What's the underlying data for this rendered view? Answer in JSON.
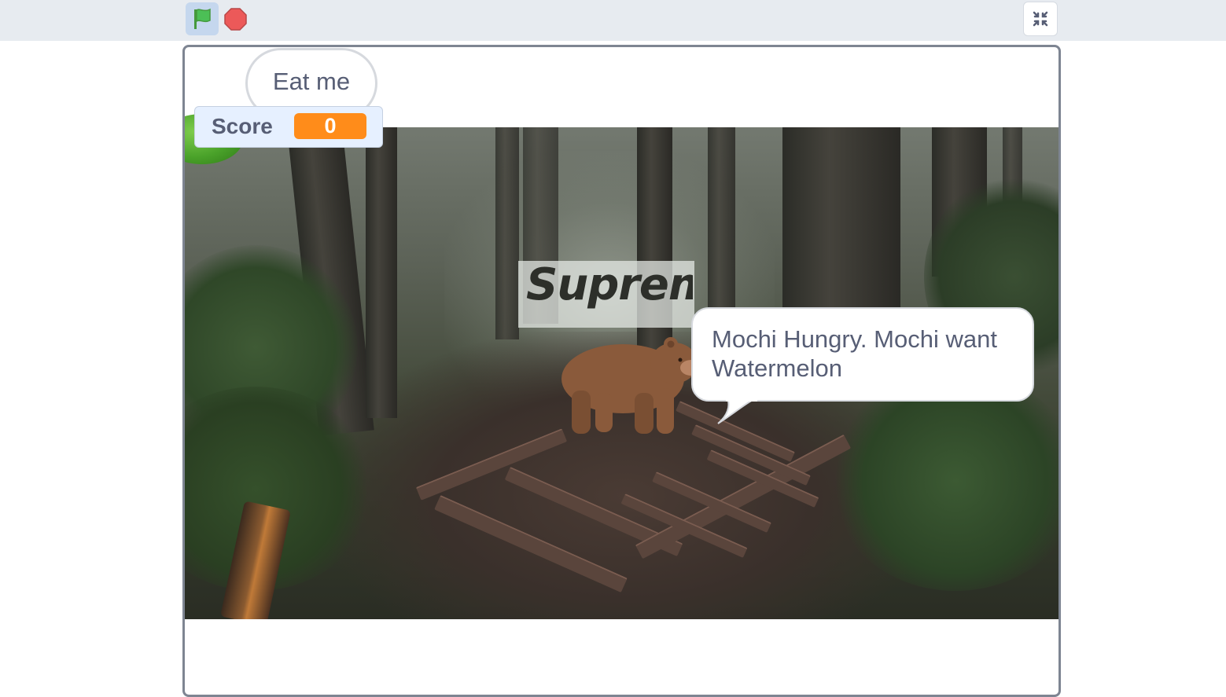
{
  "toolbar": {
    "green_flag_icon": "green-flag-icon",
    "stop_icon": "stop-sign-icon",
    "unfullscreen_icon": "exit-fullscreen-icon"
  },
  "stage": {
    "bubble_eat": "Eat me",
    "score_label": "Score",
    "score_value": "0",
    "sign_text": "Supreme",
    "bear_speech": "Mochi Hungry. Mochi want Watermelon"
  },
  "colors": {
    "toolbar_bg": "#e7ebf0",
    "monitor_bg": "#e6f0ff",
    "score_accent": "#ff8c1a",
    "text": "#575e75"
  }
}
